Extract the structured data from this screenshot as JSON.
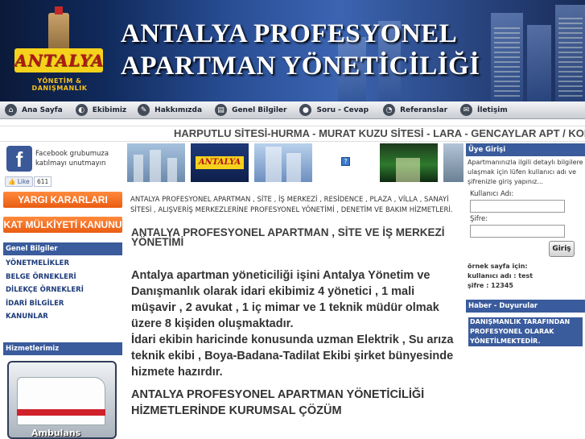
{
  "header": {
    "logo_text": "ANTALYA",
    "logo_subtitle": "YÖNETİM & DANIŞMANLIK",
    "title_line1": "ANTALYA PROFESYONEL",
    "title_line2": "APARTMAN YÖNETİCİLİĞİ"
  },
  "nav": {
    "items": [
      {
        "label": "Ana Sayfa",
        "icon": "home-icon"
      },
      {
        "label": "Ekibimiz",
        "icon": "team-icon"
      },
      {
        "label": "Hakkımızda",
        "icon": "info-icon"
      },
      {
        "label": "Genel Bilgiler",
        "icon": "document-icon"
      },
      {
        "label": "Soru - Cevap",
        "icon": "chat-icon"
      },
      {
        "label": "Referanslar",
        "icon": "rss-icon"
      },
      {
        "label": "İletişim",
        "icon": "mail-icon"
      }
    ]
  },
  "ticker": {
    "text": "HARPUTLU SİTESİ-HURMA - MURAT KUZU SİTESİ - LARA - GENCAYLAR APT / KON"
  },
  "left": {
    "facebook_text": "Facebook grubumuza katılmayı unutmayın",
    "like_label": "Like",
    "like_count": "611",
    "yargi_button": "YARGI KARARLARI",
    "kat_button": "KAT MÜLKİYETİ KANUNU",
    "genel_heading": "Genel Bilgiler",
    "genel_items": [
      "YÖNETMELİKLER",
      "BELGE ÖRNEKLERİ",
      "DİLEKÇE ÖRNEKLERİ",
      "İDARİ BİLGİLER",
      "KANUNLAR"
    ],
    "hizmet_heading": "Hizmetlerimiz",
    "ambulance_label": "Ambulans"
  },
  "center": {
    "photo_logo": "ANTALYA",
    "intro": "ANTALYA PROFESYONEL APARTMAN , SİTE , İŞ MERKEZİ , RESİDENCE , PLAZA , VİLLA , SANAYİ SİTESİ , ALIŞVERİŞ MERKEZLERİNE PROFESYONEL YÖNETİMİ , DENETİM VE BAKIM HİZMETLERİ.",
    "heading": "ANTALYA PROFESYONEL APARTMAN , SİTE VE İŞ MERKEZİ YÖNETİMİ",
    "body_p1": "Antalya apartman yöneticiliği işini Antalya Yönetim ve Danışmanlık olarak idari ekibimiz 4 yönetici , 1 mali müşavir , 2 avukat , 1 iç mimar ve 1 teknik müdür olmak üzere 8 kişiden oluşmaktadır.",
    "body_p2": "İdari ekibin haricinde konusunda uzman Elektrik , Su arıza teknik ekibi , Boya-Badana-Tadilat Ekibi şirket bünyesinde hizmete hazırdır.",
    "services_heading": "ANTALYA PROFESYONEL APARTMAN YÖNETİCİLİĞİ HİZMETLERİNDE KURUMSAL ÇÖZÜM"
  },
  "right": {
    "login_heading": "Üye Girişi",
    "login_info": "Apartmanınızla ilgili detaylı bilgilere ulaşmak için lüfen kullanıcı adı ve şifrenizle giriş yapınız...",
    "username_label": "Kullanıcı Adı:",
    "password_label": "Şifre:",
    "login_button": "Giriş",
    "sample_line1": "örnek sayfa için:",
    "sample_line2": "kullanıcı adı : test",
    "sample_line3": "şifre : 12345",
    "news_heading": "Haber - Duyurular",
    "news_text": "DANIŞMANLIK TARAFINDAN PROFESYONEL OLARAK YÖNETİLMEKTEDİR."
  },
  "colors": {
    "accent_blue": "#3a5b9c",
    "orange": "#e95c12",
    "link_blue": "#1d3b7a"
  }
}
